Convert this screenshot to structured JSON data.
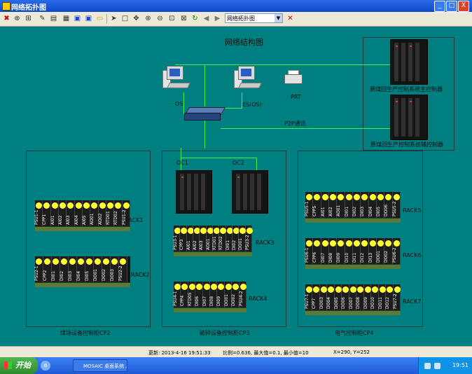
{
  "window": {
    "title": "网络拓扑图",
    "controls": [
      "_",
      "□",
      "X"
    ]
  },
  "toolbar": {
    "icons": [
      "delete-icon",
      "connector-icon",
      "group-icon",
      "pen-icon",
      "print-icon",
      "grid-icon",
      "save-icon",
      "save-as-icon",
      "open-icon",
      "pointer-icon",
      "rectangle-icon",
      "pan-icon",
      "zoom-in-icon",
      "zoom-out-icon",
      "zoom-fit-icon",
      "zoom-window-icon",
      "refresh-icon",
      "back-icon",
      "forward-icon"
    ],
    "view_select": "网络拓扑图",
    "close_glyph": "✕"
  },
  "diagram": {
    "title": "网络结构图",
    "os_label": "OS",
    "es_label": "ES(OS)",
    "prt_label": "PRT",
    "p2p_label": "P2P通讯",
    "master_controller": "原煤回生产控制系统主控制器",
    "backup_controller": "原煤回生产控制系统辅控制器",
    "oc1": "OC1",
    "oc2": "OC2",
    "cp2_label": "煤场设备控制柜CP2",
    "cp3_label": "破碎设备控制柜CP3",
    "cp4_label": "电气控制柜CP4",
    "racks": [
      {
        "id": "rack1",
        "label": "RACK1",
        "modules": [
          "PSU1-1",
          "CPP1",
          "AI01",
          "AI02",
          "AI03",
          "AI04",
          "AI05",
          "AO01",
          "AO02",
          "RTD01",
          "RTD02",
          "PSU1-2"
        ]
      },
      {
        "id": "rack2",
        "label": "RACK2",
        "modules": [
          "PSU2-1",
          "CPP2",
          "DI01",
          "DI02",
          "DI03",
          "DI04",
          "DI05",
          "DO01",
          "DO02",
          "DO03",
          "PSU2-2"
        ]
      },
      {
        "id": "rack3",
        "label": "RACK3",
        "modules": [
          "PSU3-1",
          "CPP3",
          "AI01",
          "AI02",
          "AI03",
          "AO01",
          "RTD01",
          "RTD02",
          "DI01",
          "DI02",
          "DO01",
          "PSU3-2"
        ]
      },
      {
        "id": "rack4",
        "label": "RACK4",
        "modules": [
          "PSU4-1",
          "CPP4",
          "RTD05",
          "DI06",
          "DI07",
          "DI08",
          "DI09",
          "DO01",
          "DO02",
          "PSU4-2"
        ]
      },
      {
        "id": "rack5",
        "label": "RACK5",
        "modules": [
          "PSU5-1",
          "CPP5",
          "AI01",
          "AI02",
          "AO01",
          "DI01",
          "DI02",
          "DI03",
          "DI04",
          "DI05",
          "DO06",
          "PSU5-2"
        ]
      },
      {
        "id": "rack6",
        "label": "RACK6",
        "modules": [
          "PSU6-1",
          "CPP6",
          "DI07",
          "DI08",
          "DI09",
          "DI10",
          "DI11",
          "DI12",
          "DI13",
          "DO01",
          "DO02",
          "PSU6-2"
        ]
      },
      {
        "id": "rack7",
        "label": "RACK7",
        "modules": [
          "PSU7-1",
          "CPP7",
          "DO03",
          "DO04",
          "DO05",
          "DO06",
          "DO07",
          "DO08",
          "DO09",
          "DO10",
          "DO11",
          "DO12",
          "PSU7-2"
        ]
      }
    ]
  },
  "statusbar": {
    "updated": "更新: 2013-4-16 19:51:33",
    "scale": "比例=0.636, 最大值=0.1, 最小值=10",
    "coords": "X=290, Y=252"
  },
  "taskbar": {
    "start_label": "开始",
    "task_label": "MOSAIC 桌面系统 ...",
    "clock": "19:51"
  }
}
